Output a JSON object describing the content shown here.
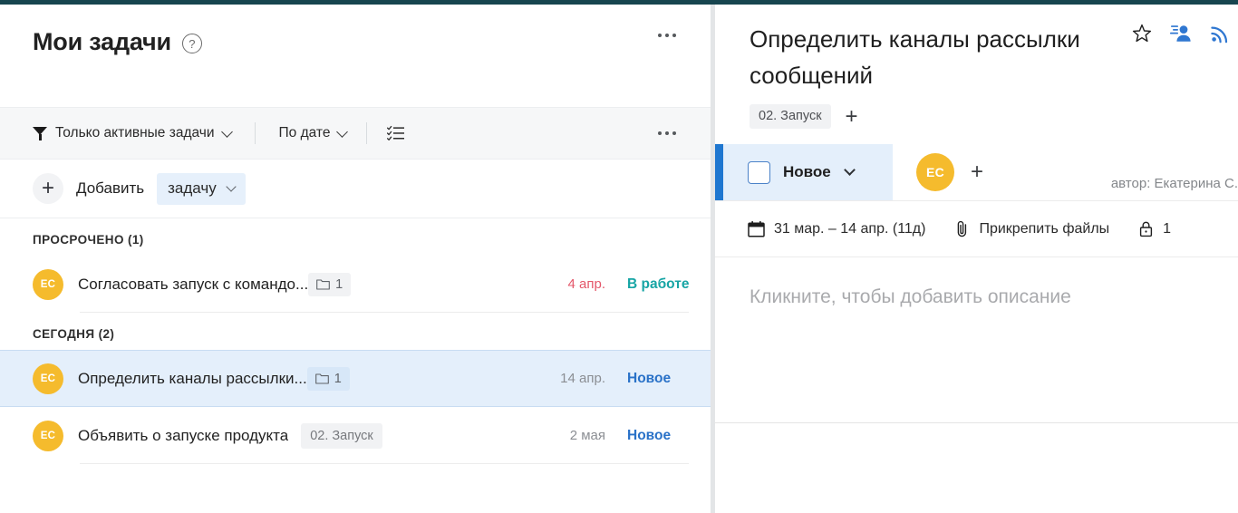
{
  "left": {
    "header": {
      "title": "Мои задачи",
      "help_icon": "question-circle-icon",
      "more_icon": "ellipsis-icon"
    },
    "toolbar": {
      "filter_label": "Только активные задачи",
      "filter_icon": "funnel-icon",
      "sort_label": "По дате",
      "checklist_icon": "checklist-icon",
      "more_icon": "ellipsis-icon"
    },
    "add": {
      "plus_icon": "plus-icon",
      "label": "Добавить",
      "entity": "задачу",
      "chevron_icon": "chevron-down-icon"
    },
    "groups": [
      {
        "title": "ПРОСРОЧЕНО (1)",
        "tasks": [
          {
            "avatar": "ЕС",
            "title": "Согласовать запуск с командо...",
            "badge_type": "folder",
            "badge_text": "1",
            "date": "4 апр.",
            "date_overdue": true,
            "status": "В работе",
            "status_kind": "work",
            "selected": false
          }
        ]
      },
      {
        "title": "СЕГОДНЯ (2)",
        "tasks": [
          {
            "avatar": "ЕС",
            "title": "Определить каналы рассылки...",
            "badge_type": "folder",
            "badge_text": "1",
            "date": "14 апр.",
            "date_overdue": false,
            "status": "Новое",
            "status_kind": "new",
            "selected": true
          },
          {
            "avatar": "ЕС",
            "title": "Объявить о запуске продукта",
            "badge_type": "tag",
            "badge_text": "02. Запуск",
            "date": "2 мая",
            "date_overdue": false,
            "status": "Новое",
            "status_kind": "new",
            "selected": false
          }
        ]
      }
    ]
  },
  "right": {
    "title": "Определить каналы рассылки сообщений",
    "icons": {
      "star": "star-outline-icon",
      "observers": "add-observer-icon",
      "subscribe": "rss-subscribe-icon"
    },
    "tag": "02. Запуск",
    "tag_add_icon": "plus-icon",
    "status": {
      "checkbox_icon": "checkbox-empty-icon",
      "label": "Новое",
      "chevron_icon": "chevron-down-icon"
    },
    "assignee": {
      "avatar": "ЕС",
      "add_icon": "plus-icon"
    },
    "author": "автор: Екатерина С.",
    "meta": {
      "dates_icon": "calendar-icon",
      "dates": "31 мар. – 14 апр. (11д)",
      "attach_icon": "paperclip-icon",
      "attach_label": "Прикрепить файлы",
      "privacy_icon": "lock-icon",
      "privacy_count": "1"
    },
    "description_placeholder": "Кликните, чтобы добавить описание"
  },
  "colors": {
    "topbar": "#17454f",
    "accent_blue": "#1f77d0",
    "avatar_yellow": "#f5bb2d",
    "status_new": "#2a72c8",
    "status_work": "#17a5a5",
    "overdue_red": "#e4576a",
    "selected_row": "#e4effb"
  }
}
